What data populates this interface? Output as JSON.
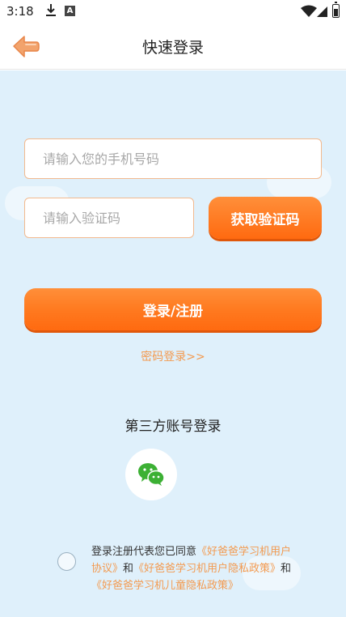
{
  "status_bar": {
    "time": "3:18",
    "a_badge": "A"
  },
  "header": {
    "title": "快速登录"
  },
  "form": {
    "phone_placeholder": "请输入您的手机号码",
    "code_placeholder": "请输入验证码",
    "get_code_label": "获取验证码",
    "login_label": "登录/注册",
    "password_login_label": "密码登录>>"
  },
  "third_party": {
    "title": "第三方账号登录",
    "wechat_icon": "wechat-icon"
  },
  "agreement": {
    "prefix": "登录注册代表您已同意",
    "user_agreement": "《好爸爸学习机用户协议》",
    "and1": "和",
    "privacy_policy": "《好爸爸学习机用户隐私政策》",
    "and2": "和",
    "child_privacy_policy": "《好爸爸学习机儿童隐私政策》"
  },
  "colors": {
    "accent": "#ff7a20",
    "link": "#f39a50",
    "background": "#dff0fb",
    "input_border": "#f2b98e"
  }
}
